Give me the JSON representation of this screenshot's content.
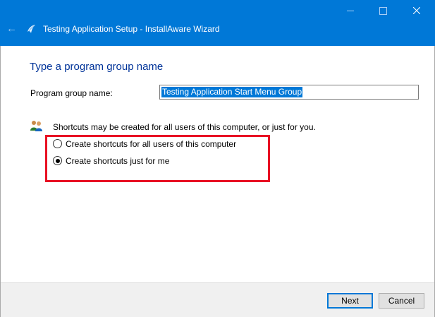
{
  "window": {
    "title": "Testing Application Setup - InstallAware Wizard",
    "accent_color": "#0078d7"
  },
  "page": {
    "heading": "Type a program group name",
    "program_group_label": "Program group name:",
    "program_group_value": "Testing Application Start Menu Group",
    "info_text": "Shortcuts may be created for all users of this computer, or just for you.",
    "options": [
      {
        "label": "Create shortcuts for all users of this computer",
        "selected": false
      },
      {
        "label": "Create shortcuts just for me",
        "selected": true
      }
    ],
    "highlight_color": "#e81123"
  },
  "footer": {
    "next_label": "Next",
    "cancel_label": "Cancel"
  },
  "icons": {
    "back": "back-arrow-icon",
    "app": "installaware-icon",
    "users": "users-icon"
  }
}
